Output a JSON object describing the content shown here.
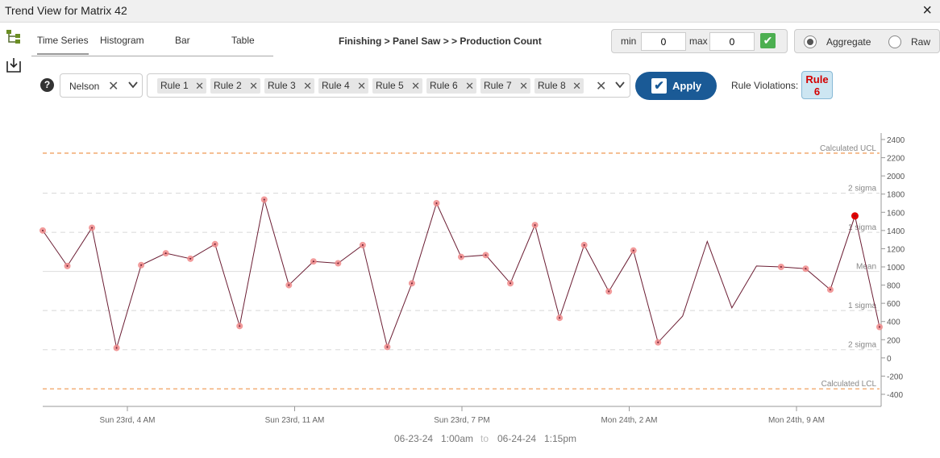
{
  "window": {
    "title": "Trend View for Matrix 42",
    "close_icon": "close-icon"
  },
  "tabs": [
    {
      "label": "Time Series",
      "active": true
    },
    {
      "label": "Histogram",
      "active": false
    },
    {
      "label": "Bar",
      "active": false
    },
    {
      "label": "Table",
      "active": false
    }
  ],
  "breadcrumb": "Finishing > Panel Saw > > Production Count",
  "range": {
    "min_label": "min",
    "min_value": "0",
    "max_label": "max",
    "max_value": "0"
  },
  "mode": {
    "aggregate_label": "Aggregate",
    "raw_label": "Raw",
    "selected": "Aggregate"
  },
  "rule_set": {
    "selected": "Nelson"
  },
  "rules": [
    "Rule 1",
    "Rule 2",
    "Rule 3",
    "Rule 4",
    "Rule 5",
    "Rule 6",
    "Rule 7",
    "Rule 8"
  ],
  "apply_label": "Apply",
  "violations": {
    "label": "Rule Violations:",
    "badge_line1": "Rule",
    "badge_line2": "6"
  },
  "date_range": {
    "from_date": "06-23-24",
    "from_time": "1:00am",
    "to": "to",
    "to_date": "06-24-24",
    "to_time": "1:15pm"
  },
  "colors": {
    "line": "#6b1d33",
    "marker": "#f08a8a",
    "violation": "#e00000",
    "limit": "#f0a060",
    "apply": "#1a5a96"
  },
  "chart_data": {
    "type": "line",
    "x_tick_labels": [
      "Sun 23rd, 4 AM",
      "Sun 23rd, 11 AM",
      "Sun 23rd, 7 PM",
      "Mon 24th, 2 AM",
      "Mon 24th, 9 AM"
    ],
    "y_ticks": [
      2400,
      2200,
      2000,
      1800,
      1600,
      1400,
      1200,
      1000,
      800,
      600,
      400,
      200,
      0,
      -200,
      -400
    ],
    "ylim": [
      -400,
      2400
    ],
    "reference_lines": [
      {
        "label": "Calculated UCL",
        "value": 2250,
        "style": "dashed-orange"
      },
      {
        "label": "2 sigma",
        "value": 1810,
        "style": "dashed-gray"
      },
      {
        "label": "1 sigma",
        "value": 1380,
        "style": "dashed-gray"
      },
      {
        "label": "Mean",
        "value": 950,
        "style": "solid-gray"
      },
      {
        "label": "1 sigma",
        "value": 520,
        "style": "dashed-gray"
      },
      {
        "label": "2 sigma",
        "value": 90,
        "style": "dashed-gray"
      },
      {
        "label": "Calculated LCL",
        "value": -340,
        "style": "dashed-orange"
      }
    ],
    "series": [
      {
        "values": [
          1400,
          1010,
          1430,
          110,
          1020,
          1150,
          1090,
          1250,
          350,
          1740,
          800,
          1060,
          1040,
          1240,
          120,
          820,
          1700,
          1110,
          1130,
          820,
          1460,
          440,
          1240,
          730,
          1180,
          170,
          460,
          1280,
          550,
          1010,
          1000,
          980,
          750,
          1560,
          340
        ],
        "marker": [
          true,
          true,
          true,
          true,
          true,
          true,
          true,
          true,
          true,
          true,
          true,
          true,
          true,
          true,
          true,
          true,
          true,
          true,
          true,
          true,
          true,
          true,
          true,
          true,
          true,
          true,
          false,
          false,
          false,
          false,
          true,
          true,
          true,
          true,
          true
        ],
        "violation_index": 33
      }
    ],
    "grid": false,
    "legend": "none"
  }
}
